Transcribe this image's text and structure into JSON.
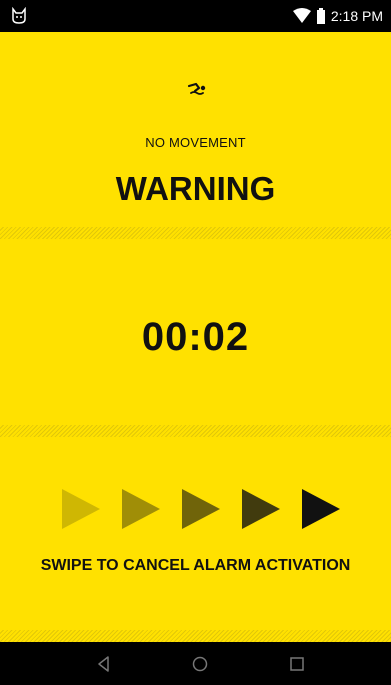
{
  "status_bar": {
    "time": "2:18 PM",
    "left_icon": "cat-icon",
    "wifi_icon": "wifi-icon",
    "battery_icon": "battery-icon"
  },
  "alarm": {
    "icon": "swimmer-icon",
    "subtitle": "NO MOVEMENT",
    "title": "WARNING",
    "countdown": "00:02",
    "swipe_label": "SWIPE TO CANCEL ALARM ACTIVATION",
    "arrow_opacities": [
      0.2,
      0.4,
      0.6,
      0.8,
      1.0
    ]
  },
  "nav_bar": {
    "back_icon": "back-icon",
    "home_icon": "home-icon",
    "recents_icon": "recents-icon"
  },
  "colors": {
    "background": "#FFE100",
    "bars": "#000000",
    "text": "#111111"
  }
}
